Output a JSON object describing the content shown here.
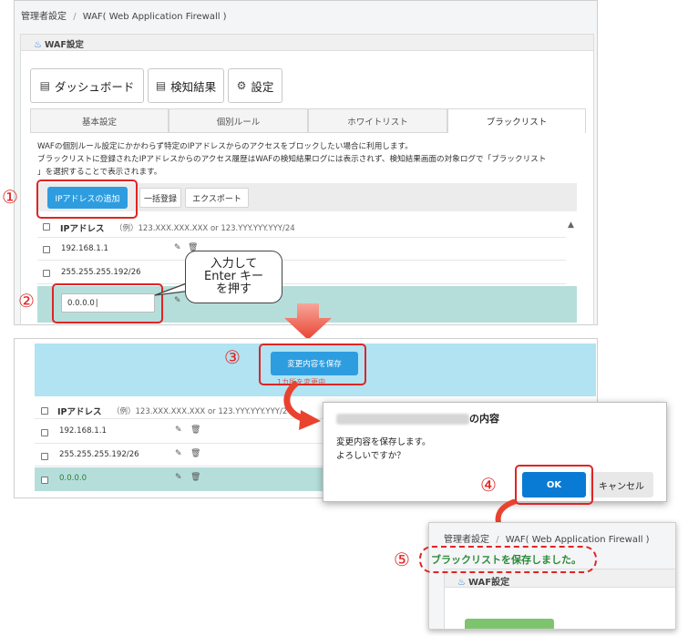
{
  "breadcrumb": {
    "admin": "管理者設定",
    "sep": "/",
    "waf": "WAF( Web Application Firewall )"
  },
  "card_title": "WAF設定",
  "big_tabs": [
    {
      "label": "ダッシュボード",
      "icon": "dashboard-icon"
    },
    {
      "label": "検知結果",
      "icon": "list-icon"
    },
    {
      "label": "設定",
      "icon": "gear-icon"
    }
  ],
  "sub_tabs": [
    "基本設定",
    "個別ルール",
    "ホワイトリスト",
    "ブラックリスト"
  ],
  "description": {
    "line1": "WAFの個別ルール設定にかかわらず特定のIPアドレスからのアクセスをブロックしたい場合に利用します。",
    "line2": "ブラックリストに登録されたIPアドレスからのアクセス履歴はWAFの検知結果ログには表示されず、検知結果画面の対象ログで「ブラックリスト",
    "line3": "」を選択することで表示されます。"
  },
  "toolbar": {
    "add_ip": "IPアドレスの追加",
    "bulk": "一括登録",
    "export": "エクスポート"
  },
  "table": {
    "header_label": "IPアドレス",
    "header_example": "（例）123.XXX.XXX.XXX or 123.YYY.YYY.YYY/24",
    "rows": [
      "192.168.1.1",
      "255.255.255.192/26"
    ],
    "new_value": "0.0.0.0"
  },
  "callout": {
    "line1": "入力して",
    "line2": "Enter キー",
    "line3": "を押す"
  },
  "steps": {
    "s1": "①",
    "s2": "②",
    "s3": "③",
    "s4": "④",
    "s5": "⑤"
  },
  "save": {
    "button": "変更内容を保存",
    "changed": "1カ所を変更中"
  },
  "panel2_rows": [
    "192.168.1.1",
    "255.255.255.192/26",
    "0.0.0.0"
  ],
  "dialog": {
    "title_suffix": "の内容",
    "line1": "変更内容を保存します。",
    "line2": "よろしいですか？",
    "ok": "OK",
    "cancel": "キャンセル"
  },
  "panel3": {
    "success": "ブラックリストを保存しました。"
  },
  "colors": {
    "accent": "#2d9de0",
    "alert": "#e02424",
    "success": "#2e8b3a",
    "teal_row": "#b5dedb",
    "cyan_bar": "#b1e3f2"
  }
}
